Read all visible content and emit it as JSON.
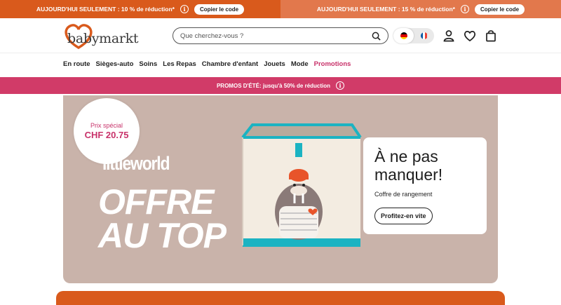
{
  "topbar": {
    "left_text": "AUJOURD'HUI SEULEMENT : 10 % de réduction*",
    "right_text": "AUJOURD'HUI SEULEMENT : 15 % de réduction*",
    "copy_label": "Copier le code",
    "info_glyph": "i",
    "colors": {
      "left": "#d95a1c",
      "right": "#e2784c"
    }
  },
  "header": {
    "logo_text": "babymarkt",
    "search_placeholder": "Que cherchez-vous ?",
    "languages": [
      "de",
      "fr"
    ],
    "active_language": "de",
    "icons": [
      "search-icon",
      "user-icon",
      "heart-icon",
      "bag-icon"
    ]
  },
  "nav": {
    "items": [
      "En route",
      "Sièges-auto",
      "Soins",
      "Les Repas",
      "Chambre d'enfant",
      "Jouets",
      "Mode"
    ],
    "promo_item": "Promotions",
    "promo_color": "#c8326a"
  },
  "summer_banner": {
    "text": "PROMOS D'ÉTÉ: jusqu'à 50% de réduction",
    "color": "#d13b68"
  },
  "hero": {
    "price_label": "Prix spécial",
    "price_value": "CHF 20.75",
    "brand": "littleworld",
    "headline_line1": "OFFRE",
    "headline_line2": "AU TOP",
    "card_title_line1": "À ne pas",
    "card_title_line2": "manquer!",
    "card_subtitle": "Coffre de rangement",
    "card_button": "Profitez-en vite",
    "background": "#c9b3aa"
  }
}
